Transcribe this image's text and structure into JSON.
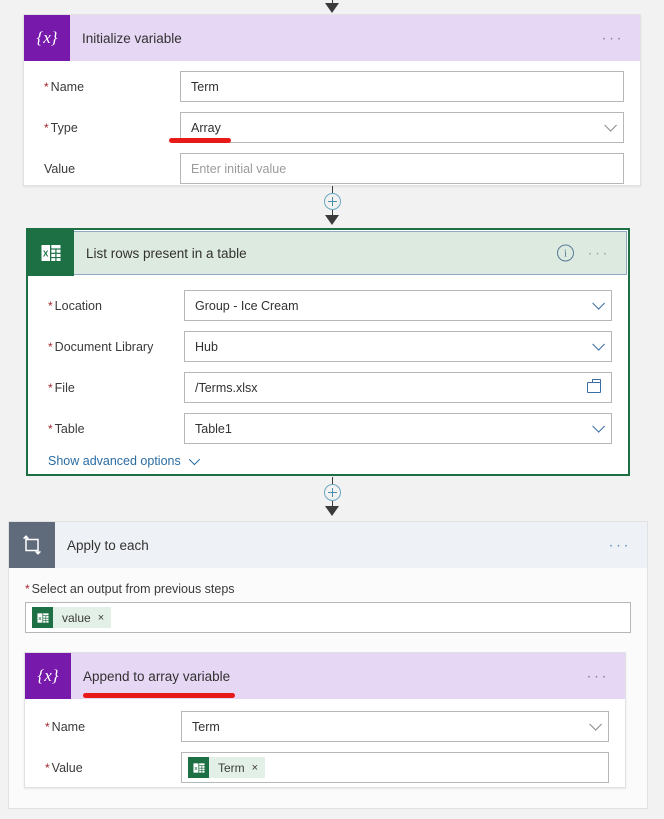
{
  "flow": {
    "steps": [
      {
        "id": "initialize-variable",
        "title": "Initialize variable",
        "icon": "variable-braces-icon",
        "accent": "#7719aa",
        "header_bg": "#e6d7f5",
        "overflow_label": "···",
        "fields": [
          {
            "label": "Name",
            "required": true,
            "value": "Term",
            "control": "text",
            "placeholder": ""
          },
          {
            "label": "Type",
            "required": true,
            "value": "Array",
            "control": "dropdown",
            "placeholder": ""
          },
          {
            "label": "Value",
            "required": false,
            "value": "",
            "control": "text",
            "placeholder": "Enter initial value"
          }
        ]
      },
      {
        "id": "list-rows-present-in-a-table",
        "title": "List rows present in a table",
        "icon": "excel-icon",
        "accent": "#1d7044",
        "header_bg": "#ddeadf",
        "info_label": "i",
        "overflow_label": "···",
        "fields": [
          {
            "label": "Location",
            "required": true,
            "value": "Group - Ice Cream",
            "control": "dropdown",
            "placeholder": ""
          },
          {
            "label": "Document Library",
            "required": true,
            "value": "Hub",
            "control": "dropdown",
            "placeholder": ""
          },
          {
            "label": "File",
            "required": true,
            "value": "/Terms.xlsx",
            "control": "filepicker",
            "placeholder": ""
          },
          {
            "label": "Table",
            "required": true,
            "value": "Table1",
            "control": "dropdown",
            "placeholder": ""
          }
        ],
        "advanced_link": "Show advanced options"
      },
      {
        "id": "apply-to-each",
        "title": "Apply to each",
        "icon": "loop-icon",
        "accent": "#5f6b7a",
        "header_bg": "#eef2f6",
        "overflow_label": "···",
        "output_label": "Select an output from previous steps",
        "output_required": true,
        "output_token": {
          "text": "value",
          "icon": "excel-icon",
          "remove_label": "×"
        },
        "child": {
          "id": "append-to-array-variable",
          "title": "Append to array variable",
          "icon": "variable-braces-icon",
          "accent": "#7719aa",
          "header_bg": "#e6d7f5",
          "overflow_label": "···",
          "fields": [
            {
              "label": "Name",
              "required": true,
              "value": "Term",
              "control": "dropdown",
              "placeholder": ""
            }
          ],
          "value_label": "Value",
          "value_required": true,
          "value_token": {
            "text": "Term",
            "icon": "excel-icon",
            "remove_label": "×"
          }
        }
      }
    ],
    "connectors": [
      {
        "id": "connector-top",
        "has_plus": false
      },
      {
        "id": "connector-one",
        "has_plus": true
      },
      {
        "id": "connector-two",
        "has_plus": true
      }
    ],
    "annotations": {
      "color": "#e81919",
      "marks": [
        {
          "id": "annotation-type-array",
          "target": "Array"
        },
        {
          "id": "annotation-append-title",
          "target": "Append to array variable"
        }
      ]
    },
    "icon_glyphs": {
      "variable-braces-icon": "{x}",
      "loop-icon": "loop",
      "excel-icon": "X"
    }
  }
}
